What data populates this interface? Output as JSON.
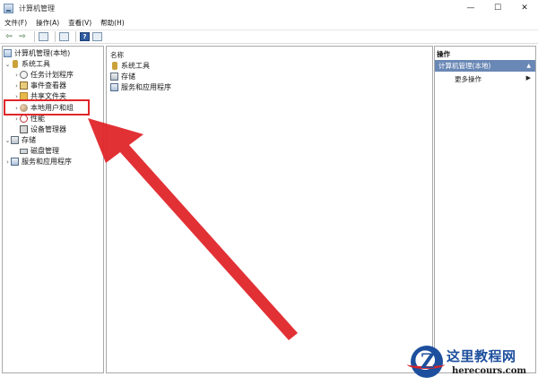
{
  "window": {
    "title": "计算机管理",
    "buttons": {
      "minimize": "—",
      "maximize": "☐",
      "close": "✕"
    }
  },
  "menu": [
    "文件(F)",
    "操作(A)",
    "查看(V)",
    "帮助(H)"
  ],
  "toolbar": {
    "back": "⇦",
    "forward": "⇨",
    "help": "?"
  },
  "tree": {
    "root": "计算机管理(本地)",
    "system_tools": "系统工具",
    "task_scheduler": "任务计划程序",
    "event_viewer": "事件查看器",
    "shared_folders": "共享文件夹",
    "local_users": "本地用户和组",
    "performance": "性能",
    "device_manager": "设备管理器",
    "storage": "存储",
    "disk_management": "磁盘管理",
    "services_apps": "服务和应用程序"
  },
  "main": {
    "header": "名称",
    "items": [
      "系统工具",
      "存储",
      "服务和应用程序"
    ]
  },
  "actions": {
    "header": "操作",
    "selected": "计算机管理(本地)",
    "more": "更多操作"
  },
  "watermark": {
    "title": "这里教程网",
    "url": "herecours.com"
  },
  "colors": {
    "highlight": "#e0262a",
    "selection": "#6a88b5"
  }
}
